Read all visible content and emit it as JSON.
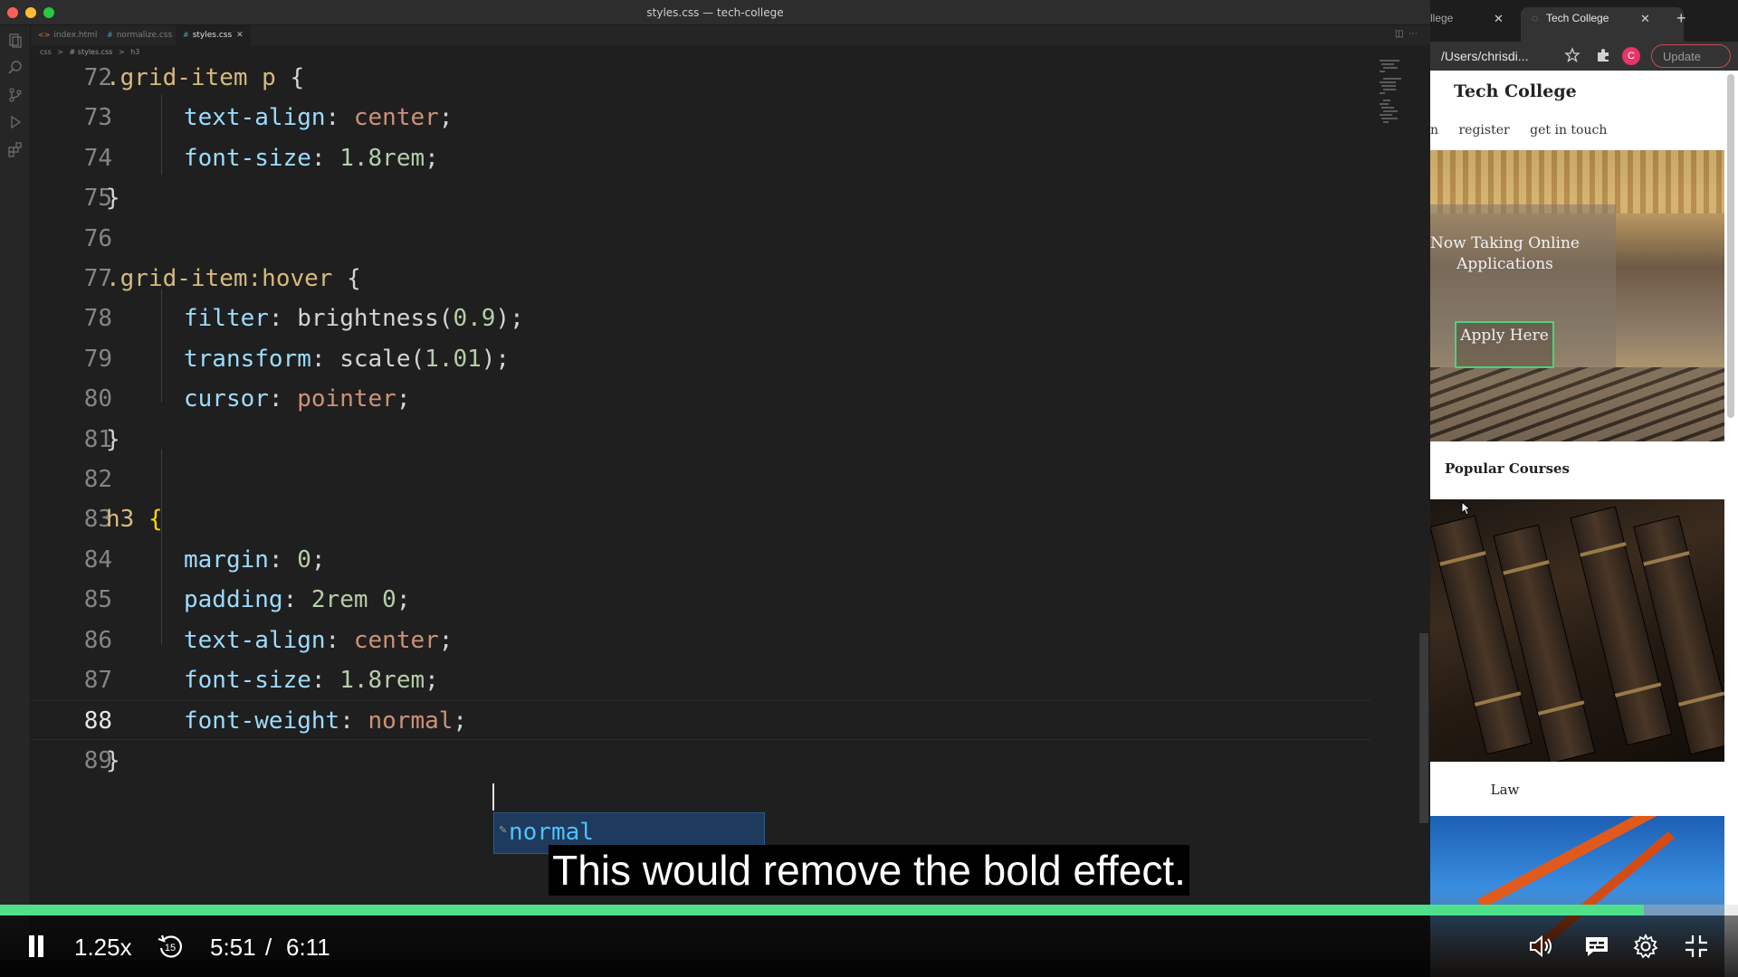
{
  "vscode": {
    "window_title": "styles.css — tech-college",
    "tabs": [
      {
        "label": "index.html",
        "icon": "html-file-icon",
        "active": false
      },
      {
        "label": "normalize.css",
        "icon": "css-file-icon",
        "active": false
      },
      {
        "label": "styles.css",
        "icon": "css-file-icon",
        "active": true
      }
    ],
    "breadcrumb": [
      "css",
      ">",
      "# styles.css",
      ">",
      "h3"
    ],
    "code_lines": [
      {
        "n": "72",
        "text": ".grid-item p {"
      },
      {
        "n": "73",
        "text": "text-align: center;"
      },
      {
        "n": "74",
        "text": "font-size: 1.8rem;"
      },
      {
        "n": "75",
        "text": "}"
      },
      {
        "n": "76",
        "text": ""
      },
      {
        "n": "77",
        "text": ".grid-item:hover {"
      },
      {
        "n": "78",
        "text": "filter: brightness(0.9);"
      },
      {
        "n": "79",
        "text": "transform: scale(1.01);"
      },
      {
        "n": "80",
        "text": "cursor: pointer;"
      },
      {
        "n": "81",
        "text": "}"
      },
      {
        "n": "82",
        "text": ""
      },
      {
        "n": "83",
        "text": "h3 {"
      },
      {
        "n": "84",
        "text": "margin: 0;"
      },
      {
        "n": "85",
        "text": "padding: 2rem 0;"
      },
      {
        "n": "86",
        "text": "text-align: center;"
      },
      {
        "n": "87",
        "text": "font-size: 1.8rem;"
      },
      {
        "n": "88",
        "text": "font-weight: normal;"
      },
      {
        "n": "89",
        "text": "}"
      }
    ],
    "current_line": "88",
    "autocomplete": {
      "suggestion": "normal",
      "icon": "keyword-icon"
    }
  },
  "browser": {
    "tabs": [
      {
        "label": "llege",
        "active": false
      },
      {
        "label": "Tech College",
        "active": true
      }
    ],
    "new_tab": "+",
    "url": "/Users/chrisdi...",
    "profile_initial": "C",
    "update_label": "Update",
    "page": {
      "title": "Tech College",
      "nav": [
        "n",
        "register",
        "get in touch"
      ],
      "hero_heading": "Now Taking Online Applications",
      "apply_button": "Apply Here",
      "popular_heading": "Popular Courses",
      "course_label": "Law"
    }
  },
  "player": {
    "subtitle": "This would remove the bold effect.",
    "speed": "1.25x",
    "rewind_seconds": "15",
    "time_current": "5:51",
    "time_separator": "/",
    "time_total": "6:11",
    "progress_fraction": 0.946,
    "accent_color": "#4ee08a",
    "icons": [
      "pause-icon",
      "rewind-15-icon",
      "volume-icon",
      "captions-icon",
      "settings-gear-icon",
      "exit-fullscreen-icon"
    ]
  }
}
